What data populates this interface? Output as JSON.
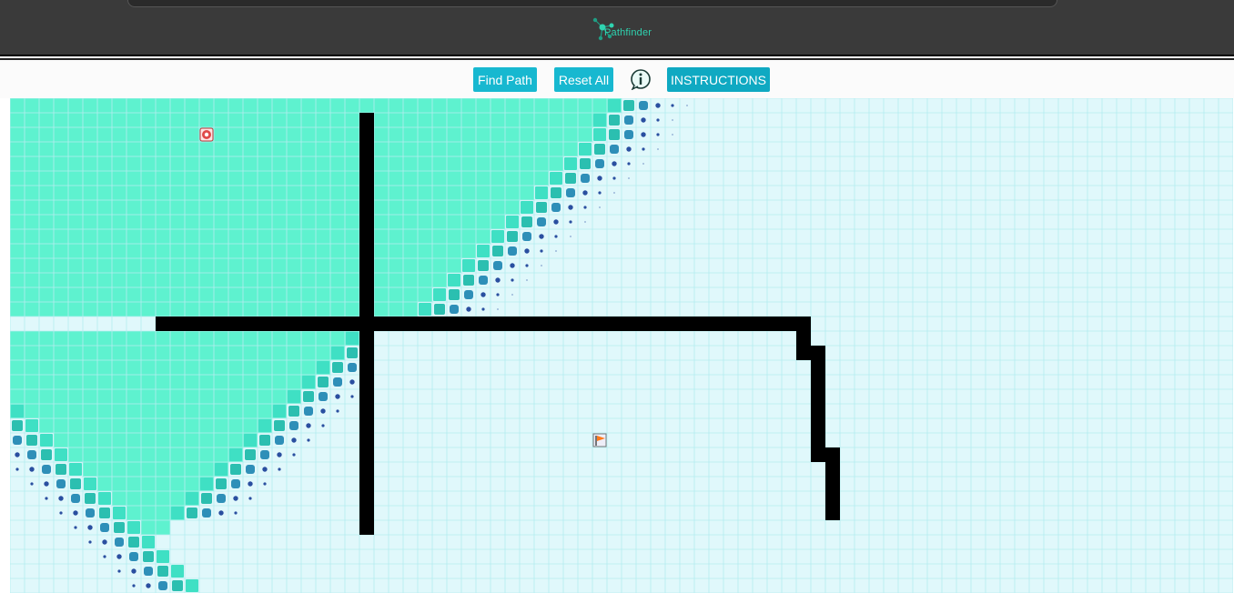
{
  "app": {
    "brand": "Pathfinder"
  },
  "toolbar": {
    "find_path_label": "Find Path",
    "reset_all_label": "Reset All",
    "info_icon": "info-circle-icon",
    "instructions_label": "INSTRUCTIONS"
  },
  "grid": {
    "cols": 84,
    "rows": 34,
    "colors": {
      "empty": "#e0f8fb",
      "empty_line": "#b4ecef",
      "visited": "#5ef2cf",
      "visited_line": "#3bc9aa",
      "frontier_a": "#3fe0c4",
      "frontier_b": "#2bbfb0",
      "frontier_c": "#2e8fb8",
      "frontier_dot": "#2a4fa0",
      "wall": "#000000"
    },
    "start": {
      "col": 13,
      "row": 2,
      "icon": "target-icon"
    },
    "target": {
      "col": 40,
      "row": 23,
      "icon": "flag-icon"
    },
    "walls": [
      {
        "c1": 24,
        "r1": 1,
        "c2": 24,
        "r2": 29
      },
      {
        "c1": 10,
        "r1": 15,
        "c2": 54,
        "r2": 15
      },
      {
        "c1": 54,
        "r1": 15,
        "c2": 54,
        "r2": 17
      },
      {
        "c1": 55,
        "r1": 17,
        "c2": 55,
        "r2": 24
      },
      {
        "c1": 56,
        "r1": 24,
        "c2": 56,
        "r2": 28
      }
    ]
  }
}
